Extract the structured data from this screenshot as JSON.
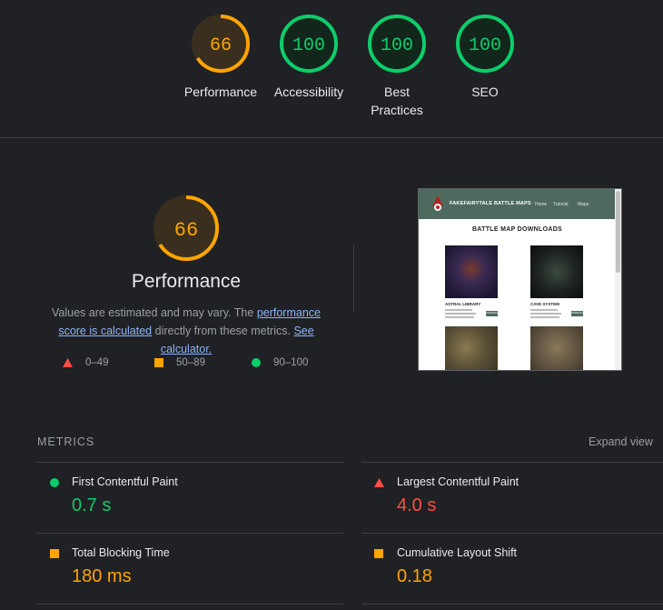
{
  "colors": {
    "pass": "#0cce6b",
    "average": "#ffa400",
    "fail": "#ff4e42",
    "link": "#8ab4f8",
    "background": "#202124"
  },
  "categories": [
    {
      "label": "Performance",
      "score": 66,
      "status": "average"
    },
    {
      "label": "Accessibility",
      "score": 100,
      "status": "pass"
    },
    {
      "label": "Best\nPractices",
      "score": 100,
      "status": "pass"
    },
    {
      "label": "SEO",
      "score": 100,
      "status": "pass"
    }
  ],
  "performance": {
    "score": 66,
    "title": "Performance",
    "desc_prefix": "Values are estimated and may vary. The ",
    "desc_link1": "performance score is calculated",
    "desc_middle": " directly from these metrics. ",
    "desc_link2": "See calculator."
  },
  "legend": [
    {
      "shape": "triangle",
      "range": "0–49"
    },
    {
      "shape": "square",
      "range": "50–89"
    },
    {
      "shape": "circle",
      "range": "90–100"
    }
  ],
  "screenshot": {
    "brand": "FAKEFAIRYTALE BATTLE MAPS",
    "nav": [
      "Home",
      "Tutorial",
      "Maps"
    ],
    "heading": "BATTLE MAP DOWNLOADS",
    "items": [
      {
        "name": "ASTRAL LIBRARY",
        "button": "DOWNLOAD",
        "map_color": "#2a2240"
      },
      {
        "name": "CAVE SYSTEM",
        "button": "DOWNLOAD",
        "map_color": "#1f2522"
      },
      {
        "name": "",
        "button": "",
        "map_color": "#5a5036"
      },
      {
        "name": "",
        "button": "",
        "map_color": "#5f5240"
      }
    ]
  },
  "metrics": {
    "title": "METRICS",
    "expand_label": "Expand view",
    "items": [
      {
        "name": "First Contentful Paint",
        "value": "0.7 s",
        "status": "pass"
      },
      {
        "name": "Largest Contentful Paint",
        "value": "4.0 s",
        "status": "fail"
      },
      {
        "name": "Total Blocking Time",
        "value": "180 ms",
        "status": "average"
      },
      {
        "name": "Cumulative Layout Shift",
        "value": "0.18",
        "status": "average"
      }
    ]
  }
}
